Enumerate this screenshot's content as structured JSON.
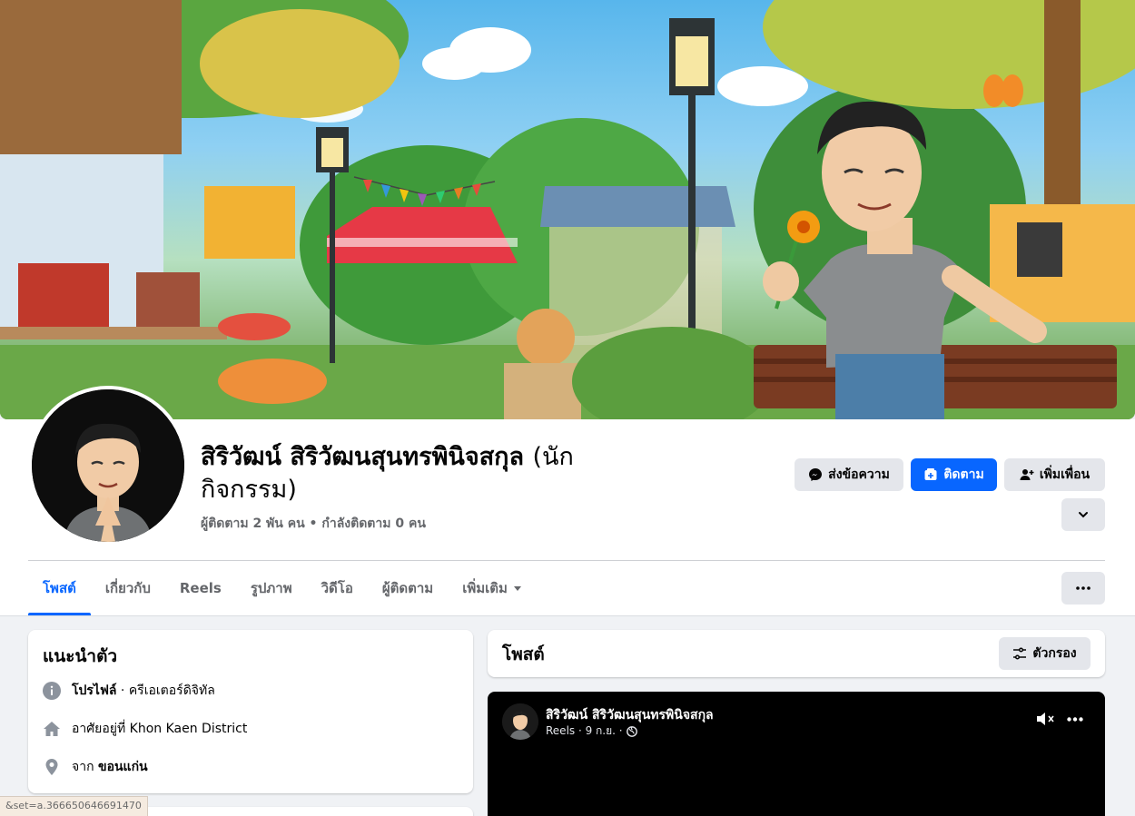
{
  "profile": {
    "name": "สิริวัฒน์ สิริวัฒนสุนทรพินิจสกุล",
    "subtitle_line1": "(นัก",
    "subtitle_line2": "กิจกรรม)",
    "followers": "ผู้ติดตาม 2 พัน คน",
    "separator": "•",
    "following": "กำลังติดตาม 0 คน"
  },
  "actions": {
    "message": "ส่งข้อความ",
    "follow": "ติดตาม",
    "add_friend": "เพิ่มเพื่อน"
  },
  "tabs": [
    {
      "label": "โพสต์"
    },
    {
      "label": "เกี่ยวกับ"
    },
    {
      "label": "Reels"
    },
    {
      "label": "รูปภาพ"
    },
    {
      "label": "วิดีโอ"
    },
    {
      "label": "ผู้ติดตาม"
    },
    {
      "label": "เพิ่มเติม"
    }
  ],
  "intro": {
    "title": "แนะนำตัว",
    "profile_label": "โปรไฟล์",
    "profile_value": " · ครีเอเตอร์ดิจิทัล",
    "lives_in": "อาศัยอยู่ที่ Khon Kaen District",
    "from_label": "จาก ",
    "from_value": "ขอนแก่น"
  },
  "posts": {
    "title": "โพสต์",
    "filter": "ตัวกรอง"
  },
  "post": {
    "author": "สิริวัฒน์ สิริวัฒนสุนทรพินิจสกุล",
    "meta": "Reels · 9 ก.ย. ·"
  },
  "status_url": "&set=a.366650646691470",
  "colors": {
    "accent": "#0866ff",
    "page_bg": "#f0f2f5",
    "button_grey": "#e4e6eb"
  }
}
